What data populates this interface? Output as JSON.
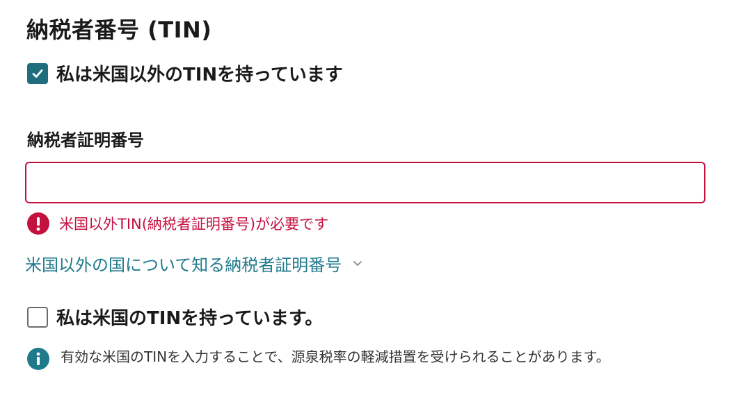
{
  "section": {
    "title": "納税者番号 (TIN)"
  },
  "foreign_tin_checkbox": {
    "label": "私は米国以外のTINを持っています",
    "checked": true
  },
  "tin_field": {
    "label": "納税者証明番号",
    "value": "",
    "placeholder": ""
  },
  "error": {
    "message": "米国以外TIN(納税者証明番号)が必要です",
    "icon": "error-icon"
  },
  "expand_link": {
    "label": "米国以外の国について知る納税者証明番号",
    "icon": "chevron-down-icon"
  },
  "us_tin_checkbox": {
    "label": "私は米国のTINを持っています。",
    "checked": false
  },
  "info": {
    "message": "有効な米国のTINを入力することで、源泉税率の軽減措置を受けられることがあります。",
    "icon": "info-icon"
  },
  "colors": {
    "accent": "#1f6e7e",
    "link": "#1f7a8c",
    "error": "#c4123f",
    "text": "#1a1a1a"
  }
}
